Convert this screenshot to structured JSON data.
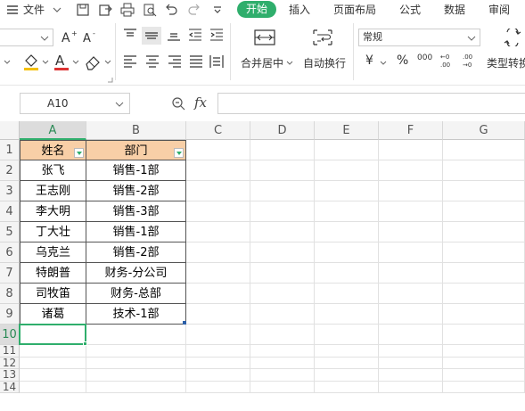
{
  "menubar": {
    "hamburger_icon": "menu-icon",
    "file_label": "文件",
    "tabs": [
      "开始",
      "插入",
      "页面布局",
      "公式",
      "数据",
      "审阅"
    ]
  },
  "ribbon": {
    "number_format": "常规",
    "merge_center_label": "合并居中",
    "wrap_text_label": "自动换行",
    "type_convert_label": "类型转换",
    "currency_symbol": "¥",
    "percent_symbol": "%",
    "thousands_symbol": "000",
    "fontsize_value": ""
  },
  "formula_bar": {
    "name_box": "A10",
    "fx_label": "fx",
    "formula": ""
  },
  "sheet": {
    "columns": [
      "A",
      "B",
      "C",
      "D",
      "E",
      "F",
      "G"
    ],
    "rows": [
      "1",
      "2",
      "3",
      "4",
      "5",
      "6",
      "7",
      "8",
      "9",
      "10",
      "11",
      "12",
      "13",
      "14"
    ],
    "header": [
      "姓名",
      "部门"
    ],
    "data": [
      [
        "张飞",
        "销售-1部"
      ],
      [
        "王志刚",
        "销售-2部"
      ],
      [
        "李大明",
        "销售-3部"
      ],
      [
        "丁大壮",
        "销售-1部"
      ],
      [
        "乌克兰",
        "销售-2部"
      ],
      [
        "特朗普",
        "财务-分公司"
      ],
      [
        "司牧笛",
        "财务-总部"
      ],
      [
        "诸葛",
        "技术-1部"
      ]
    ],
    "active_cell": "A10"
  },
  "colors": {
    "accent": "#2fae6c",
    "header_fill": "#f8cfa7"
  }
}
